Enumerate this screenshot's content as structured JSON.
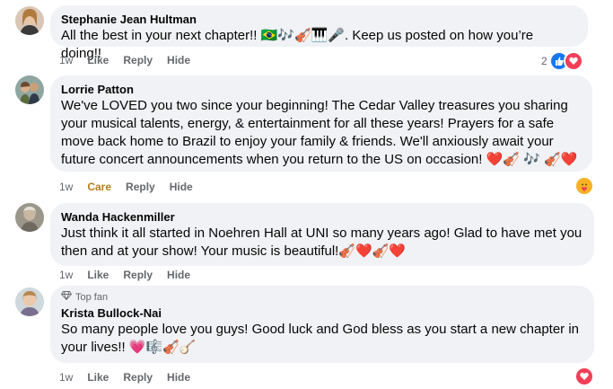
{
  "comments": [
    {
      "author": "Stephanie Jean Hultman",
      "text": "All the best in your next chapter!! 🇧🇷🎶🎻🎹🎤. Keep us posted on how you’re doing!!",
      "time": "1w",
      "actions": [
        "Like",
        "Reply",
        "Hide"
      ],
      "reaction_count": "2"
    },
    {
      "author": "Lorrie Patton",
      "text": "We've LOVED you two since your beginning! The Cedar Valley treasures you sharing your musical talents, energy, & entertainment for all these years! Prayers for a safe move back home to Brazil to enjoy your family & friends. We'll anxiously await your future concert announcements when you return to the US on occasion! ❤️🎻 🎶 🎻❤️",
      "time": "1w",
      "actions": [
        "Care",
        "Reply",
        "Hide"
      ]
    },
    {
      "author": "Wanda Hackenmiller",
      "text": "Just think it all started in Noehren Hall at UNI so many years ago! Glad to have met you then and at your show! Your music is beautiful!🎻❤️🎻❤️",
      "time": "1w",
      "actions": [
        "Like",
        "Reply",
        "Hide"
      ]
    },
    {
      "author": "Krista Bullock-Nai",
      "badge": "Top fan",
      "text": "So many people love you guys! Good luck and God bless as you start a new chapter in your lives!! 💗🎼🎻🪕",
      "time": "1w",
      "actions": [
        "Like",
        "Reply",
        "Hide"
      ]
    }
  ],
  "colors": {
    "bubble": "#f0f2f5",
    "meta": "#65676b",
    "like_blue": "#1877f2",
    "love_red": "#f33e58",
    "care_gold": "#b37e1d"
  }
}
